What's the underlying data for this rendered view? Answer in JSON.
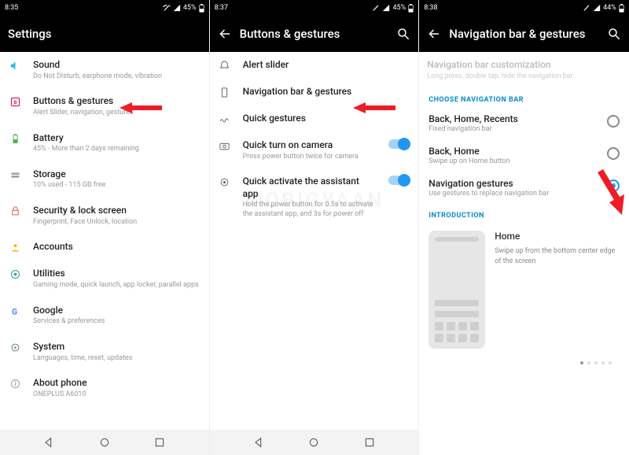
{
  "watermark": "MOBIGYAAN",
  "panel1": {
    "status": {
      "time": "8:35",
      "battery": "45%"
    },
    "title": "Settings",
    "items": [
      {
        "icon": "sound",
        "label": "Sound",
        "sub": "Do Not Disturb, earphone mode, vibration"
      },
      {
        "icon": "buttons",
        "label": "Buttons & gestures",
        "sub": "Alert Slider, navigation, gestures"
      },
      {
        "icon": "battery",
        "label": "Battery",
        "sub": "45% - More than 2 days remaining"
      },
      {
        "icon": "storage",
        "label": "Storage",
        "sub": "10% used - 115 GB free"
      },
      {
        "icon": "security",
        "label": "Security & lock screen",
        "sub": "Fingerprint, Face Unlock, location"
      },
      {
        "icon": "accounts",
        "label": "Accounts",
        "sub": ""
      },
      {
        "icon": "utilities",
        "label": "Utilities",
        "sub": "Gaming mode, quick launch, app locker, parallel apps"
      },
      {
        "icon": "google",
        "label": "Google",
        "sub": "Services & preferences"
      },
      {
        "icon": "system",
        "label": "System",
        "sub": "Languages, time, reset, updates"
      },
      {
        "icon": "about",
        "label": "About phone",
        "sub": "ONEPLUS A6010"
      }
    ]
  },
  "panel2": {
    "status": {
      "time": "8:37",
      "battery": "45%"
    },
    "title": "Buttons & gestures",
    "items": [
      {
        "icon": "slider",
        "label": "Alert slider",
        "sub": ""
      },
      {
        "icon": "phone",
        "label": "Navigation bar & gestures",
        "sub": ""
      },
      {
        "icon": "gesture",
        "label": "Quick gestures",
        "sub": ""
      },
      {
        "icon": "camera",
        "label": "Quick turn on camera",
        "sub": "Press power button twice for camera",
        "switch": true
      },
      {
        "icon": "assist",
        "label": "Quick activate the assistant app",
        "sub": "Hold the power button for 0.5s to activate the assistant app, and 3s for power off",
        "switch": true
      }
    ]
  },
  "panel3": {
    "status": {
      "time": "8:38",
      "battery": "44%"
    },
    "title": "Navigation bar & gestures",
    "disabled": {
      "label": "Navigation bar customization",
      "sub": "Long press, double tap, hide the navigation bar"
    },
    "sec_choose": "CHOOSE NAVIGATION BAR",
    "options": [
      {
        "label": "Back, Home, Recents",
        "sub": "Fixed navigation bar",
        "checked": false
      },
      {
        "label": "Back, Home",
        "sub": "Swipe up on Home button",
        "checked": false
      },
      {
        "label": "Navigation gestures",
        "sub": "Use gestures to replace navigation bar",
        "checked": true
      }
    ],
    "sec_intro": "INTRODUCTION",
    "intro": {
      "label": "Home",
      "sub": "Swipe up from the bottom center edge of the screen"
    }
  }
}
